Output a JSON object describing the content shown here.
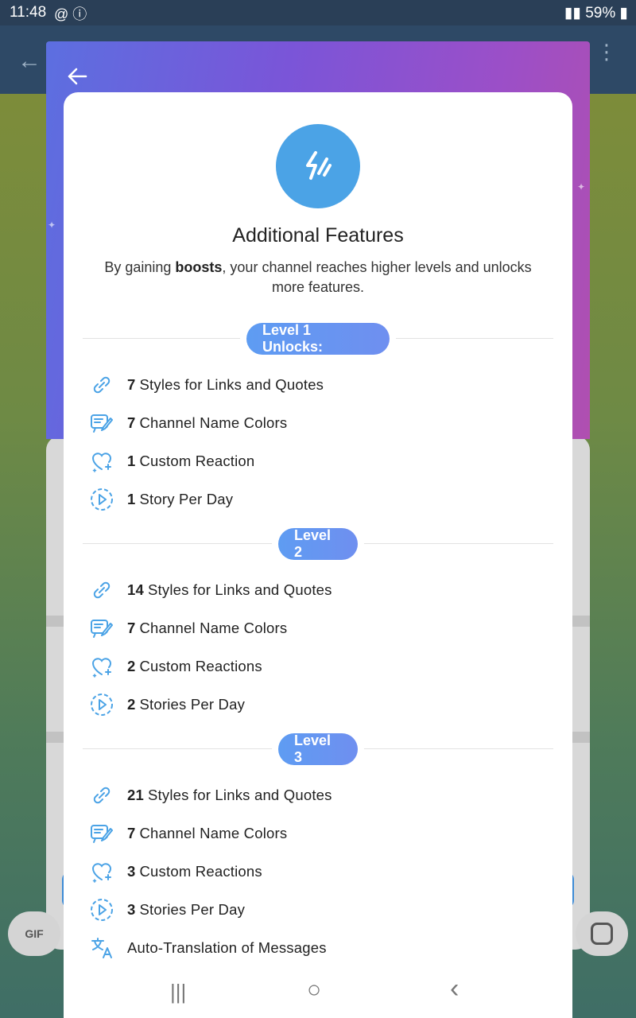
{
  "status_bar": {
    "time": "11:48",
    "left_icons": "@ ⓘ",
    "battery": "59%"
  },
  "sheet": {
    "title": "Additional Features",
    "description_prefix": "By gaining ",
    "description_bold": "boosts",
    "description_suffix": ", your channel reaches higher levels and unlocks more features."
  },
  "levels": [
    {
      "label": "Level 1 Unlocks:",
      "features": [
        {
          "icon": "link-icon",
          "num": "7",
          "text": "Styles for Links and Quotes"
        },
        {
          "icon": "palette-brush-icon",
          "num": "7",
          "text": "Channel Name Colors"
        },
        {
          "icon": "heart-sparkle-icon",
          "num": "1",
          "text": "Custom Reaction"
        },
        {
          "icon": "story-play-icon",
          "num": "1",
          "text": "Story Per Day"
        }
      ]
    },
    {
      "label": "Level 2",
      "features": [
        {
          "icon": "link-icon",
          "num": "14",
          "text": "Styles for Links and Quotes"
        },
        {
          "icon": "palette-brush-icon",
          "num": "7",
          "text": "Channel Name Colors"
        },
        {
          "icon": "heart-sparkle-icon",
          "num": "2",
          "text": "Custom Reactions"
        },
        {
          "icon": "story-play-icon",
          "num": "2",
          "text": "Stories Per Day"
        }
      ]
    },
    {
      "label": "Level 3",
      "features": [
        {
          "icon": "link-icon",
          "num": "21",
          "text": "Styles for Links and Quotes"
        },
        {
          "icon": "palette-brush-icon",
          "num": "7",
          "text": "Channel Name Colors"
        },
        {
          "icon": "heart-sparkle-icon",
          "num": "3",
          "text": "Custom Reactions"
        },
        {
          "icon": "story-play-icon",
          "num": "3",
          "text": "Stories Per Day"
        },
        {
          "icon": "translate-icon",
          "num": "",
          "text": "Auto-Translation of Messages"
        }
      ]
    }
  ],
  "background": {
    "gif_label": "GIF"
  },
  "nav": {
    "recents": "|||",
    "home": "○",
    "back": "‹"
  },
  "colors": {
    "accent": "#4ba3e6",
    "pill": "#6f8ff0",
    "icon": "#4ba3e6"
  }
}
